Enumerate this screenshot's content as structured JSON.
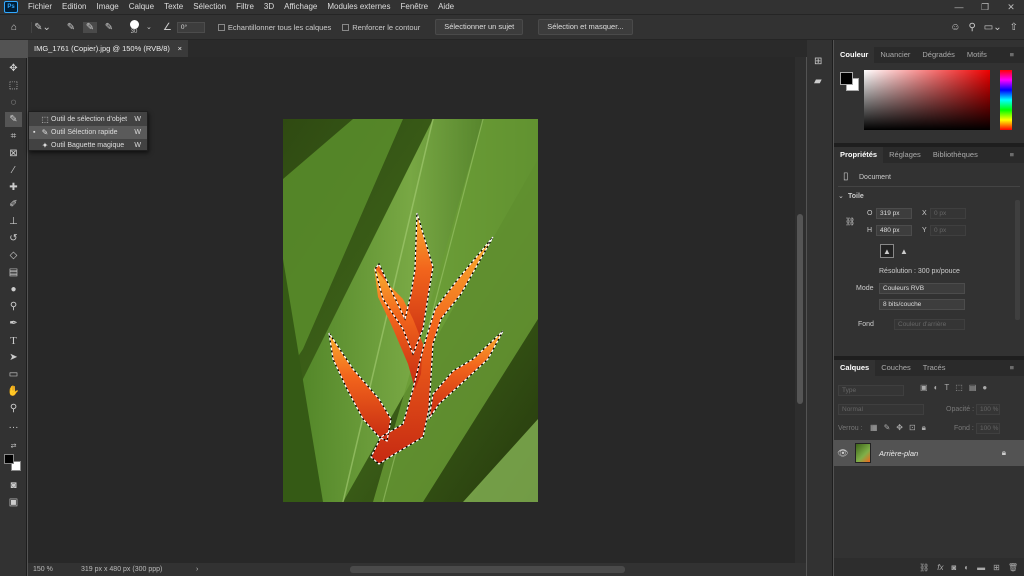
{
  "app": {
    "logo": "Ps"
  },
  "menu": [
    "Fichier",
    "Edition",
    "Image",
    "Calque",
    "Texte",
    "Sélection",
    "Filtre",
    "3D",
    "Affichage",
    "Modules externes",
    "Fenêtre",
    "Aide"
  ],
  "window_controls": {
    "minimize": "—",
    "maximize": "❐",
    "close": "✕"
  },
  "options": {
    "brush_size": "30",
    "angle": "0°",
    "sample_all_layers": "Echantillonner tous les calques",
    "enhance_edge": "Renforcer le contour",
    "select_subject": "Sélectionner un sujet",
    "select_and_mask": "Sélection et masquer..."
  },
  "document": {
    "tab_title": "IMG_1761 (Copier).jpg @ 150% (RVB/8)",
    "close": "×"
  },
  "flyout": [
    {
      "label": "Outil de sélection d'objet",
      "shortcut": "W",
      "selected": false,
      "marker": ""
    },
    {
      "label": "Outil Sélection rapide",
      "shortcut": "W",
      "selected": true,
      "marker": "▪"
    },
    {
      "label": "Outil Baguette magique",
      "shortcut": "W",
      "selected": false,
      "marker": ""
    }
  ],
  "status": {
    "zoom": "150 %",
    "info": "319 px x 480 px (300 ppp)",
    "arrow": "›"
  },
  "color_panel": {
    "tabs": [
      "Couleur",
      "Nuancier",
      "Dégradés",
      "Motifs"
    ],
    "foreground": "#000000",
    "background": "#ffffff",
    "menu": "≡"
  },
  "properties": {
    "tabs": [
      "Propriétés",
      "Réglages",
      "Bibliothèques"
    ],
    "doc_label": "Document",
    "section": "Toile",
    "section_arrow": "⌄",
    "w_label": "O",
    "w_value": "319 px",
    "h_label": "H",
    "h_value": "480 px",
    "x_label": "X",
    "x_value": "0 px",
    "y_label": "Y",
    "y_value": "0 px",
    "resolution": "Résolution : 300 px/pouce",
    "mode_label": "Mode",
    "mode_value": "Couleurs RVB",
    "depth_value": "8 bits/couche",
    "fond_label": "Fond",
    "fond_value": "Couleur d'arrière"
  },
  "layers": {
    "tabs": [
      "Calques",
      "Couches",
      "Tracés"
    ],
    "filter_placeholder": "Type",
    "blend": "Normal",
    "opacity_label": "Opacité :",
    "opacity_value": "100 %",
    "lock_label": "Verrou :",
    "fill_label": "Fond :",
    "fill_value": "100 %",
    "layer_name": "Arrière-plan"
  },
  "accent": "#31a8ff"
}
